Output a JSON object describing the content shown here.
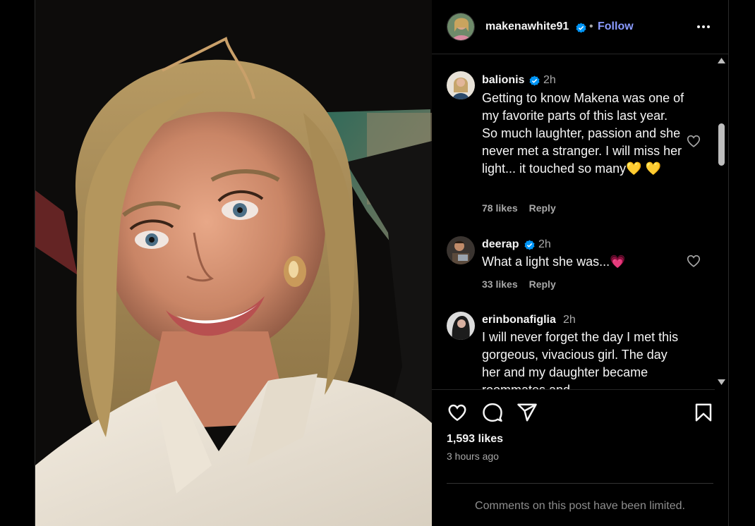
{
  "post": {
    "author": "makenawhite91",
    "separator": "•",
    "follow_label": "Follow",
    "likes": "1,593 likes",
    "time_ago": "3 hours ago",
    "comments_limited": "Comments on this post have been limited."
  },
  "comments": [
    {
      "user": "balionis",
      "verified": true,
      "time": "2h",
      "text": "Getting to know Makena was one of my favorite parts of this last year. So much laughter, passion and she never met a stranger. I will miss her light... it touched so many💛 💛",
      "likes": "78 likes",
      "reply_label": "Reply"
    },
    {
      "user": "deerap",
      "verified": true,
      "time": "2h",
      "text": "What a light she was...💗",
      "likes": "33 likes",
      "reply_label": "Reply"
    },
    {
      "user": "erinbonafiglia",
      "verified": false,
      "time": "2h",
      "text": "I will never forget the day I met this gorgeous, vivacious girl. The day her and my daughter became roommates and"
    }
  ],
  "icons": {
    "more": "more-options-icon",
    "like": "heart-icon",
    "comment": "comment-bubble-icon",
    "share": "share-plane-icon",
    "save": "bookmark-icon",
    "verified": "verified-badge-icon"
  },
  "colors": {
    "background": "#000000",
    "text": "#f5f5f5",
    "muted": "#a8a8a8",
    "follow": "#8a9bff",
    "verified": "#0095f6"
  }
}
